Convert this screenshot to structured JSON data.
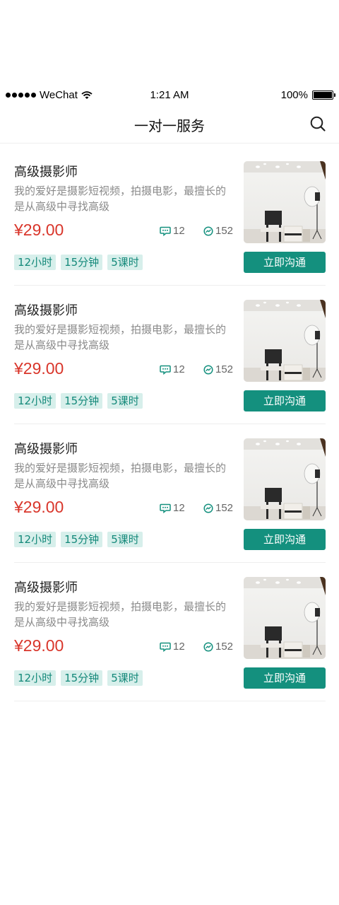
{
  "status_bar": {
    "carrier": "WeChat",
    "time": "1:21 AM",
    "battery": "100%"
  },
  "nav": {
    "title": "一对一服务",
    "search_icon": "search-icon"
  },
  "colors": {
    "accent": "#14907e",
    "price": "#d9362b",
    "tag_bg": "#d7efeb",
    "tag_text": "#14897a"
  },
  "services": [
    {
      "name": "高级摄影师",
      "description": "我的爱好是摄影短视频，拍摄电影，最擅长的是从高级中寻找高级",
      "price": "¥29.00",
      "comments": "12",
      "views": "152",
      "tags": [
        "12小时",
        "15分钟",
        "5课时"
      ],
      "button": "立即沟通",
      "thumbnail": "photo-studio-image"
    },
    {
      "name": "高级摄影师",
      "description": "我的爱好是摄影短视频，拍摄电影，最擅长的是从高级中寻找高级",
      "price": "¥29.00",
      "comments": "12",
      "views": "152",
      "tags": [
        "12小时",
        "15分钟",
        "5课时"
      ],
      "button": "立即沟通",
      "thumbnail": "photo-studio-image"
    },
    {
      "name": "高级摄影师",
      "description": "我的爱好是摄影短视频，拍摄电影，最擅长的是从高级中寻找高级",
      "price": "¥29.00",
      "comments": "12",
      "views": "152",
      "tags": [
        "12小时",
        "15分钟",
        "5课时"
      ],
      "button": "立即沟通",
      "thumbnail": "photo-studio-image"
    },
    {
      "name": "高级摄影师",
      "description": "我的爱好是摄影短视频，拍摄电影，最擅长的是从高级中寻找高级",
      "price": "¥29.00",
      "comments": "12",
      "views": "152",
      "tags": [
        "12小时",
        "15分钟",
        "5课时"
      ],
      "button": "立即沟通",
      "thumbnail": "photo-studio-image"
    }
  ]
}
